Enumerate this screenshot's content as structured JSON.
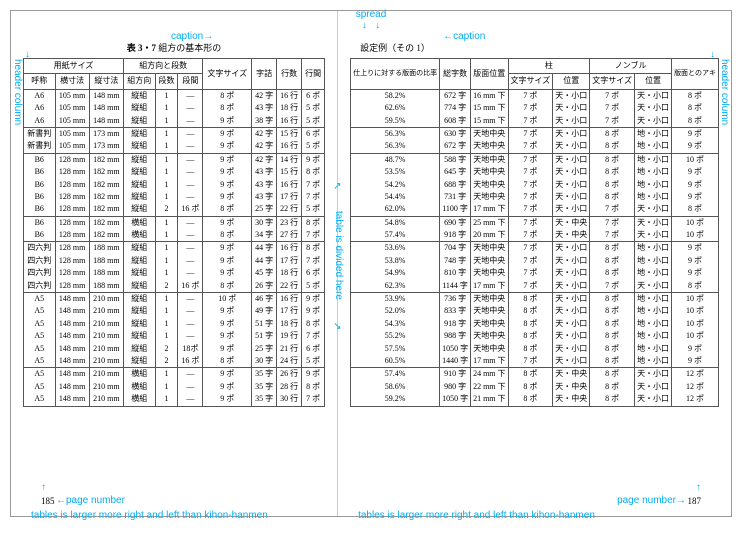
{
  "annotations": {
    "spread": "spread",
    "caption": "caption",
    "header_column": "header column",
    "table_divided": "table is divided here",
    "page_number": "page number",
    "tables_larger": "tables is larger more right and left than kihon-hanmen"
  },
  "left": {
    "caption_prefix": "表 3・7",
    "caption_text": "組方の基本形の",
    "page_number": "185",
    "headers": {
      "paper_size": "用紙サイズ",
      "direction_cols": "組方向と段数",
      "name": "呼称",
      "width": "横寸法",
      "height": "縦寸法",
      "dir": "組方向",
      "cols": "段数",
      "gap": "段間",
      "char_size": "文字サイズ",
      "chars": "字詰",
      "lines": "行数",
      "leading": "行間"
    },
    "groups": [
      [
        [
          "A6",
          "105 mm",
          "148 mm",
          "縦組",
          "1",
          "—",
          "8 ポ",
          "42 字",
          "16 行",
          "6 ポ"
        ],
        [
          "A6",
          "105 mm",
          "148 mm",
          "縦組",
          "1",
          "—",
          "8 ポ",
          "43 字",
          "18 行",
          "5 ポ"
        ],
        [
          "A6",
          "105 mm",
          "148 mm",
          "縦組",
          "1",
          "—",
          "9 ポ",
          "38 字",
          "16 行",
          "5 ポ"
        ]
      ],
      [
        [
          "新書判",
          "105 mm",
          "173 mm",
          "縦組",
          "1",
          "—",
          "9 ポ",
          "42 字",
          "15 行",
          "6 ポ"
        ],
        [
          "新書判",
          "105 mm",
          "173 mm",
          "縦組",
          "1",
          "—",
          "9 ポ",
          "42 字",
          "16 行",
          "5 ポ"
        ]
      ],
      [
        [
          "B6",
          "128 mm",
          "182 mm",
          "縦組",
          "1",
          "—",
          "9 ポ",
          "42 字",
          "14 行",
          "9 ポ"
        ],
        [
          "B6",
          "128 mm",
          "182 mm",
          "縦組",
          "1",
          "—",
          "9 ポ",
          "43 字",
          "15 行",
          "8 ポ"
        ],
        [
          "B6",
          "128 mm",
          "182 mm",
          "縦組",
          "1",
          "—",
          "9 ポ",
          "43 字",
          "16 行",
          "7 ポ"
        ],
        [
          "B6",
          "128 mm",
          "182 mm",
          "縦組",
          "1",
          "—",
          "9 ポ",
          "43 字",
          "17 行",
          "7 ポ"
        ],
        [
          "B6",
          "128 mm",
          "182 mm",
          "縦組",
          "2",
          "16 ポ",
          "8 ポ",
          "25 字",
          "22 行",
          "5 ポ"
        ]
      ],
      [
        [
          "B6",
          "128 mm",
          "182 mm",
          "横組",
          "1",
          "—",
          "9 ポ",
          "30 字",
          "23 行",
          "8 ポ"
        ],
        [
          "B6",
          "128 mm",
          "182 mm",
          "横組",
          "1",
          "—",
          "8 ポ",
          "34 字",
          "27 行",
          "7 ポ"
        ]
      ],
      [
        [
          "四六判",
          "128 mm",
          "188 mm",
          "縦組",
          "1",
          "—",
          "9 ポ",
          "44 字",
          "16 行",
          "8 ポ"
        ],
        [
          "四六判",
          "128 mm",
          "188 mm",
          "縦組",
          "1",
          "—",
          "9 ポ",
          "44 字",
          "17 行",
          "7 ポ"
        ],
        [
          "四六判",
          "128 mm",
          "188 mm",
          "縦組",
          "1",
          "—",
          "9 ポ",
          "45 字",
          "18 行",
          "6 ポ"
        ],
        [
          "四六判",
          "128 mm",
          "188 mm",
          "縦組",
          "2",
          "16 ポ",
          "8 ポ",
          "26 字",
          "22 行",
          "5 ポ"
        ]
      ],
      [
        [
          "A5",
          "148 mm",
          "210 mm",
          "縦組",
          "1",
          "—",
          "10 ポ",
          "46 字",
          "16 行",
          "9 ポ"
        ],
        [
          "A5",
          "148 mm",
          "210 mm",
          "縦組",
          "1",
          "—",
          "9 ポ",
          "49 字",
          "17 行",
          "9 ポ"
        ],
        [
          "A5",
          "148 mm",
          "210 mm",
          "縦組",
          "1",
          "—",
          "9 ポ",
          "51 字",
          "18 行",
          "8 ポ"
        ],
        [
          "A5",
          "148 mm",
          "210 mm",
          "縦組",
          "1",
          "—",
          "9 ポ",
          "51 字",
          "19 行",
          "7 ポ"
        ],
        [
          "A5",
          "148 mm",
          "210 mm",
          "縦組",
          "2",
          "18ポ",
          "9 ポ",
          "25 字",
          "21 行",
          "6 ポ"
        ],
        [
          "A5",
          "148 mm",
          "210 mm",
          "縦組",
          "2",
          "16 ポ",
          "8 ポ",
          "30 字",
          "24 行",
          "5 ポ"
        ]
      ],
      [
        [
          "A5",
          "148 mm",
          "210 mm",
          "横組",
          "1",
          "—",
          "9 ポ",
          "35 字",
          "26 行",
          "9 ポ"
        ],
        [
          "A5",
          "148 mm",
          "210 mm",
          "横組",
          "1",
          "—",
          "9 ポ",
          "35 字",
          "28 行",
          "8 ポ"
        ],
        [
          "A5",
          "148 mm",
          "210 mm",
          "横組",
          "1",
          "—",
          "9 ポ",
          "35 字",
          "30 行",
          "7 ポ"
        ]
      ]
    ]
  },
  "right": {
    "caption_text": "設定例（その 1）",
    "page_number": "187",
    "headers": {
      "ratio": "仕上りに対する版面の比率",
      "total_chars": "総字数",
      "hanmen_pos": "版面位置",
      "hashira": "柱",
      "nombre": "ノンブル",
      "hanmen_aki": "版面とのアキ",
      "char_size": "文字サイズ",
      "position": "位置"
    },
    "groups": [
      [
        [
          "58.2%",
          "672 字",
          "16 mm 下",
          "7 ポ",
          "天・小口",
          "7 ポ",
          "天・小口",
          "8 ポ"
        ],
        [
          "62.6%",
          "774 字",
          "15 mm 下",
          "7 ポ",
          "天・小口",
          "7 ポ",
          "天・小口",
          "8 ポ"
        ],
        [
          "59.5%",
          "608 字",
          "15 mm 下",
          "7 ポ",
          "天・小口",
          "7 ポ",
          "天・小口",
          "8 ポ"
        ]
      ],
      [
        [
          "56.3%",
          "630 字",
          "天地中央",
          "7 ポ",
          "天・小口",
          "8 ポ",
          "地・小口",
          "9 ポ"
        ],
        [
          "56.3%",
          "672 字",
          "天地中央",
          "7 ポ",
          "天・小口",
          "8 ポ",
          "地・小口",
          "9 ポ"
        ]
      ],
      [
        [
          "48.7%",
          "588 字",
          "天地中央",
          "7 ポ",
          "天・小口",
          "8 ポ",
          "地・小口",
          "10 ポ"
        ],
        [
          "53.5%",
          "645 字",
          "天地中央",
          "7 ポ",
          "天・小口",
          "8 ポ",
          "地・小口",
          "9 ポ"
        ],
        [
          "54.2%",
          "688 字",
          "天地中央",
          "7 ポ",
          "天・小口",
          "8 ポ",
          "地・小口",
          "9 ポ"
        ],
        [
          "54.4%",
          "731 字",
          "天地中央",
          "7 ポ",
          "天・小口",
          "8 ポ",
          "地・小口",
          "9 ポ"
        ],
        [
          "62.0%",
          "1100 字",
          "17 mm 下",
          "7 ポ",
          "天・小口",
          "7 ポ",
          "天・小口",
          "8 ポ"
        ]
      ],
      [
        [
          "54.8%",
          "690 字",
          "25 mm 下",
          "7 ポ",
          "天・中央",
          "7 ポ",
          "天・小口",
          "10 ポ"
        ],
        [
          "57.4%",
          "918 字",
          "20 mm 下",
          "7 ポ",
          "天・中央",
          "7 ポ",
          "天・小口",
          "10 ポ"
        ]
      ],
      [
        [
          "53.6%",
          "704 字",
          "天地中央",
          "7 ポ",
          "天・小口",
          "8 ポ",
          "地・小口",
          "9 ポ"
        ],
        [
          "53.8%",
          "748 字",
          "天地中央",
          "7 ポ",
          "天・小口",
          "8 ポ",
          "地・小口",
          "9 ポ"
        ],
        [
          "54.9%",
          "810 字",
          "天地中央",
          "7 ポ",
          "天・小口",
          "8 ポ",
          "地・小口",
          "9 ポ"
        ],
        [
          "62.3%",
          "1144 字",
          "17 mm 下",
          "7 ポ",
          "天・小口",
          "7 ポ",
          "天・小口",
          "8 ポ"
        ]
      ],
      [
        [
          "53.9%",
          "736 字",
          "天地中央",
          "8 ポ",
          "天・小口",
          "8 ポ",
          "地・小口",
          "10 ポ"
        ],
        [
          "52.0%",
          "833 字",
          "天地中央",
          "8 ポ",
          "天・小口",
          "8 ポ",
          "地・小口",
          "10 ポ"
        ],
        [
          "54.3%",
          "918 字",
          "天地中央",
          "8 ポ",
          "天・小口",
          "8 ポ",
          "地・小口",
          "10 ポ"
        ],
        [
          "55.2%",
          "988 字",
          "天地中央",
          "8 ポ",
          "天・小口",
          "8 ポ",
          "地・小口",
          "10 ポ"
        ],
        [
          "57.5%",
          "1050 字",
          "天地中央",
          "8 ポ",
          "天・小口",
          "8 ポ",
          "地・小口",
          "9 ポ"
        ],
        [
          "60.5%",
          "1440 字",
          "17 mm 下",
          "7 ポ",
          "天・小口",
          "8 ポ",
          "地・小口",
          "9 ポ"
        ]
      ],
      [
        [
          "57.4%",
          "910 字",
          "24 mm 下",
          "8 ポ",
          "天・中央",
          "8 ポ",
          "天・小口",
          "12 ポ"
        ],
        [
          "58.6%",
          "980 字",
          "22 mm 下",
          "8 ポ",
          "天・中央",
          "8 ポ",
          "天・小口",
          "12 ポ"
        ],
        [
          "59.2%",
          "1050 字",
          "21 mm 下",
          "8 ポ",
          "天・中央",
          "8 ポ",
          "天・小口",
          "12 ポ"
        ]
      ]
    ]
  }
}
